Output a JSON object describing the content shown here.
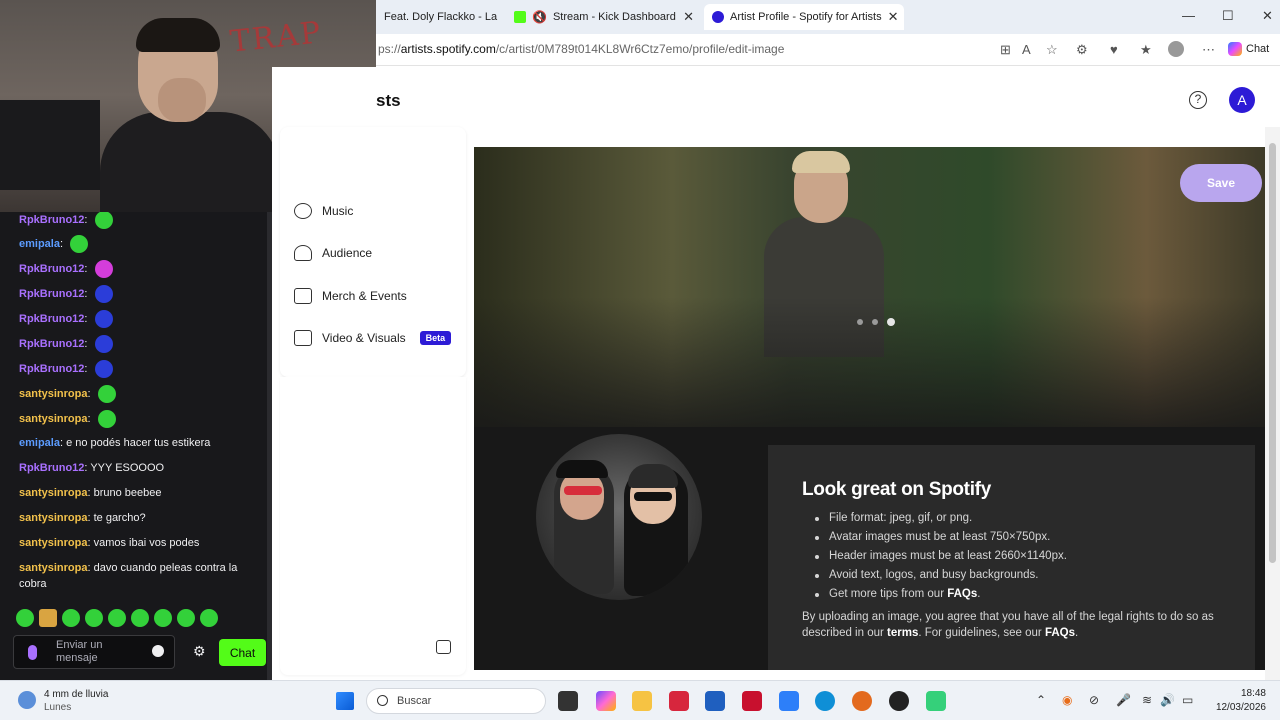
{
  "browser": {
    "tabs": [
      {
        "label": "Feat. Doly Flackko - La S",
        "active": false
      },
      {
        "label": "Stream - Kick Dashboard",
        "active": false
      },
      {
        "label": "Artist Profile - Spotify for Artists",
        "active": true
      }
    ],
    "url_prefix": "ps://",
    "url_host": "artists.spotify.com",
    "url_path": "/c/artist/0M789t014KL8Wr6Ctz7emo/profile/edit-image",
    "chat_label": "Chat"
  },
  "webcam": {
    "wall_text": "TRAP"
  },
  "chat": {
    "messages": [
      {
        "user": "RpkBruno12",
        "user_color": "#a970ff",
        "text": "",
        "emote": "green"
      },
      {
        "user": "emipala",
        "user_color": "#5c9cff",
        "text": "",
        "emote": "green"
      },
      {
        "user": "RpkBruno12",
        "user_color": "#a970ff",
        "text": "",
        "emote": "pink"
      },
      {
        "user": "RpkBruno12",
        "user_color": "#a970ff",
        "text": "",
        "emote": "blue"
      },
      {
        "user": "RpkBruno12",
        "user_color": "#a970ff",
        "text": "",
        "emote": "blue"
      },
      {
        "user": "RpkBruno12",
        "user_color": "#a970ff",
        "text": "",
        "emote": "blue"
      },
      {
        "user": "RpkBruno12",
        "user_color": "#a970ff",
        "text": "",
        "emote": "blue"
      },
      {
        "user": "santysinropa",
        "user_color": "#f2c14b",
        "text": "",
        "emote": "green"
      },
      {
        "user": "santysinropa",
        "user_color": "#f2c14b",
        "text": "",
        "emote": "green"
      },
      {
        "user": "emipala",
        "user_color": "#5c9cff",
        "text": "e no podés hacer tus estikera",
        "emote": ""
      },
      {
        "user": "RpkBruno12",
        "user_color": "#a970ff",
        "text": "YYY ESOOOO",
        "emote": ""
      },
      {
        "user": "santysinropa",
        "user_color": "#f2c14b",
        "text": "bruno beebee",
        "emote": ""
      },
      {
        "user": "santysinropa",
        "user_color": "#f2c14b",
        "text": "te garcho?",
        "emote": ""
      },
      {
        "user": "santysinropa",
        "user_color": "#f2c14b",
        "text": "vamos ibai vos podes",
        "emote": ""
      },
      {
        "user": "santysinropa",
        "user_color": "#f2c14b",
        "text": "davo cuando peleas contra la cobra",
        "emote": ""
      }
    ],
    "input_placeholder": "Enviar un mensaje",
    "send_label": "Chat"
  },
  "spotify": {
    "brand": "sts",
    "avatar_initial": "A",
    "help_icon": "?",
    "nav": [
      {
        "label": "Music",
        "icon": "music-icon",
        "beta": false
      },
      {
        "label": "Audience",
        "icon": "audience-icon",
        "beta": false
      },
      {
        "label": "Merch & Events",
        "icon": "merch-icon",
        "beta": false
      },
      {
        "label": "Video & Visuals",
        "icon": "video-icon",
        "beta": true
      }
    ],
    "beta_label": "Beta",
    "save_label": "Save",
    "info": {
      "title": "Look great on Spotify",
      "bullets": [
        "File format: jpeg, gif, or png.",
        "Avatar images must be at least 750×750px.",
        "Header images must be at least 2660×1140px.",
        "Avoid text, logos, and busy backgrounds."
      ],
      "tips_prefix": "Get more tips from our ",
      "tips_link": "FAQs",
      "tips_suffix": ".",
      "legal_1": "By uploading an image, you agree that you have all of the legal rights to do so as described in our ",
      "legal_terms": "terms",
      "legal_2": ". For guidelines, see our ",
      "legal_faqs": "FAQs",
      "legal_3": "."
    }
  },
  "taskbar": {
    "weather_title": "4 mm de lluvia",
    "weather_sub": "Lunes",
    "search_placeholder": "Buscar",
    "time": "18:48",
    "date": "12/03/2026"
  }
}
